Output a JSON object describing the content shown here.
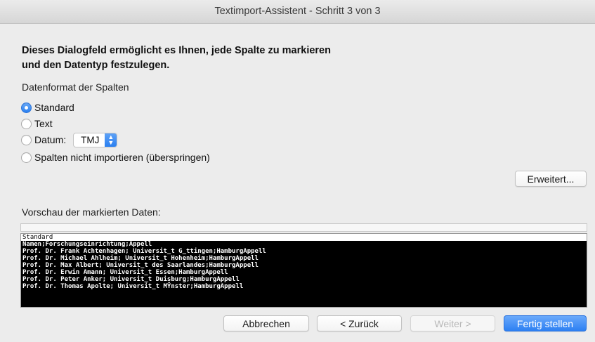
{
  "window": {
    "title": "Textimport-Assistent - Schritt 3 von 3"
  },
  "heading": {
    "line1": "Dieses Dialogfeld ermöglicht es Ihnen, jede Spalte zu markieren",
    "line2": "und den Datentyp festzulegen."
  },
  "format": {
    "label": "Datenformat der Spalten",
    "options": [
      {
        "label": "Standard",
        "checked": true
      },
      {
        "label": "Text",
        "checked": false
      },
      {
        "label": "Datum:",
        "checked": false
      },
      {
        "label": "Spalten nicht importieren (überspringen)",
        "checked": false
      }
    ],
    "date_select": {
      "value": "TMJ"
    }
  },
  "advanced_button": "Erweitert...",
  "preview": {
    "label": "Vorschau der markierten Daten:",
    "header": "Standard",
    "lines": [
      "Namen;Forschungseinrichtung;Appell",
      "Prof. Dr. Frank Achtenhagen; Universit_t G_ttingen;HamburgAppell",
      "Prof. Dr. Michael Ahlheim; Universit_t Hohenheim;HamburgAppell",
      "Prof. Dr. Max Albert; Universit_t des Saarlandes;HamburgAppell",
      "Prof. Dr. Erwin Amann; Universit_t Essen;HamburgAppell",
      "Prof. Dr. Peter Anker; Universit_t Duisburg;HamburgAppell",
      "Prof. Dr. Thomas Apolte; Universit_t MŸnster;HamburgAppell"
    ]
  },
  "buttons": {
    "cancel": "Abbrechen",
    "back": "< Zurück",
    "next": "Weiter >",
    "finish": "Fertig stellen"
  },
  "colors": {
    "accent": "#2d80f2",
    "preview_bg": "#000000"
  }
}
